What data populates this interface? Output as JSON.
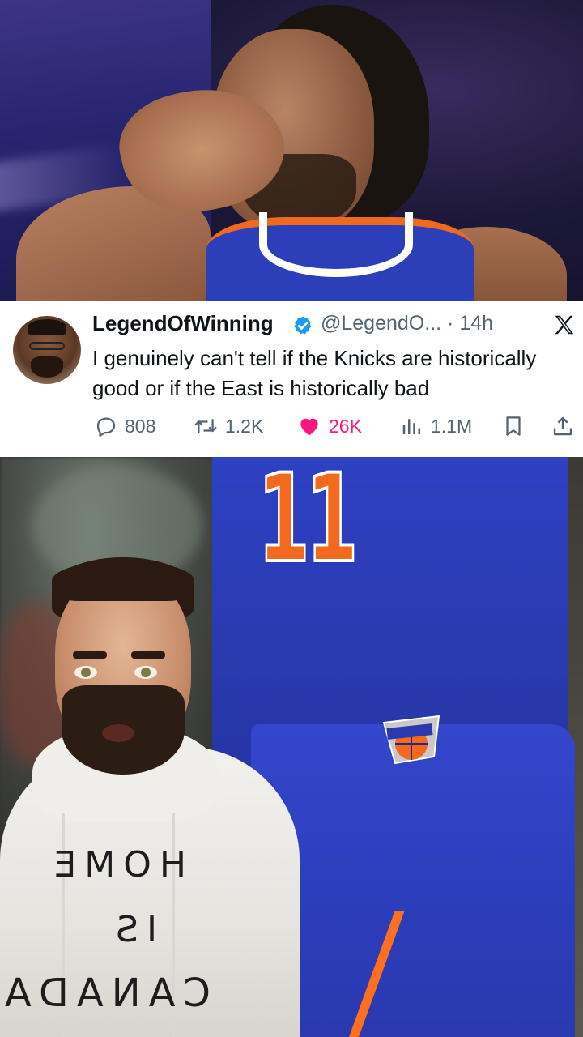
{
  "tweet": {
    "display_name": "LegendOfWinning",
    "handle": "@LegendO...",
    "separator": "·",
    "time": "14h",
    "text": "I genuinely can't tell if the Knicks are historically good or if the East is historically bad",
    "stats": {
      "replies": "808",
      "reposts": "1.2K",
      "likes": "26K",
      "views": "1.1M"
    },
    "icons": [
      "verified-badge-icon",
      "x-logo-icon",
      "reply-icon",
      "repost-icon",
      "like-icon",
      "views-icon",
      "bookmark-icon",
      "share-icon"
    ],
    "colors": {
      "like_active": "#f91880",
      "verified": "#1d9bf0",
      "muted_text": "#536471",
      "primary_text": "#0f1419"
    }
  },
  "photo_top": {
    "subject": "Knicks player",
    "jersey_colors": [
      "#2d3fb8",
      "#ef6a1f",
      "#ffffff"
    ]
  },
  "photo_bottom": {
    "jersey_number": "11",
    "hoodie_text_lines": [
      "HOME",
      "IS",
      "CANADA"
    ]
  }
}
